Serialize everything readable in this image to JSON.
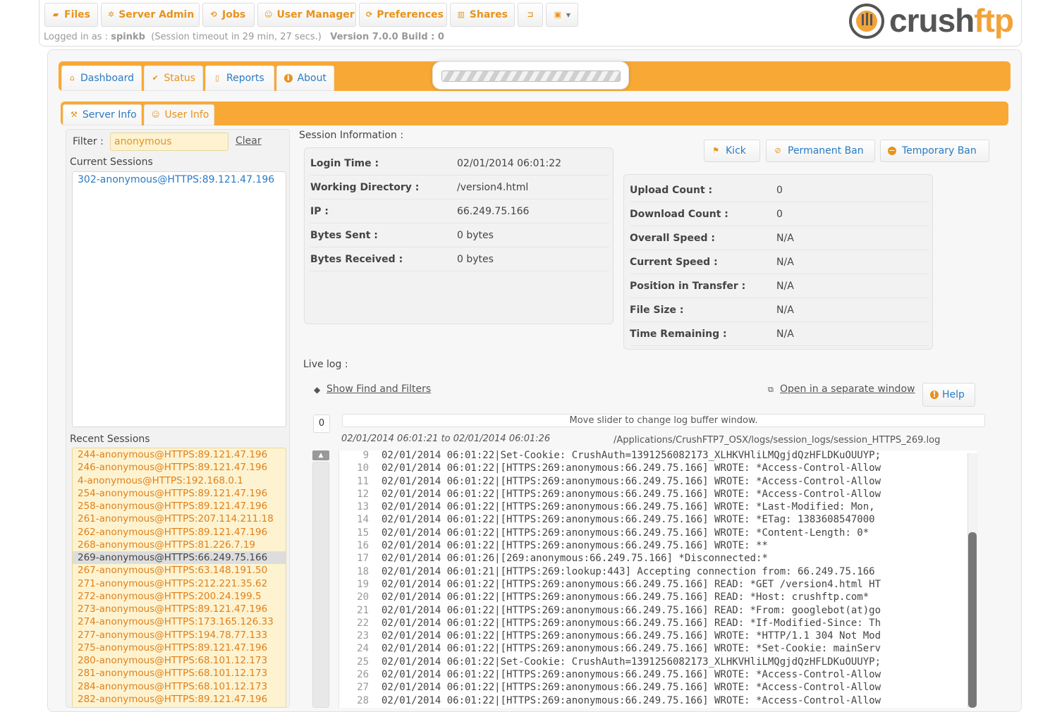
{
  "topnav": {
    "files": "Files",
    "server_admin": "Server Admin",
    "jobs": "Jobs",
    "user_manager": "User Manager",
    "preferences": "Preferences",
    "shares": "Shares"
  },
  "status_line": {
    "logged_in_label": "Logged in as :",
    "user": "spinkb",
    "timeout": "(Session timeout in 29 min, 27 secs.)",
    "version": "Version 7.0.0 Build : 0"
  },
  "logo": {
    "part1": "crush",
    "part2": "ftp"
  },
  "main_tabs": [
    "Dashboard",
    "Status",
    "Reports",
    "About"
  ],
  "sub_tabs": [
    "Server Info",
    "User Info"
  ],
  "filter": {
    "label": "Filter :",
    "value": "anonymous",
    "clear": "Clear"
  },
  "current_sessions": {
    "title": "Current Sessions",
    "items": [
      "302-anonymous@HTTPS:89.121.47.196"
    ]
  },
  "recent_sessions": {
    "title": "Recent Sessions",
    "selected_index": 8,
    "items": [
      "244-anonymous@HTTPS:89.121.47.196",
      "246-anonymous@HTTPS:89.121.47.196",
      "4-anonymous@HTTPS:192.168.0.1",
      "254-anonymous@HTTPS:89.121.47.196",
      "258-anonymous@HTTPS:89.121.47.196",
      "261-anonymous@HTTPS:207.114.211.18",
      "262-anonymous@HTTPS:89.121.47.196",
      "268-anonymous@HTTPS:81.226.7.19",
      "269-anonymous@HTTPS:66.249.75.166",
      "267-anonymous@HTTPS:63.148.191.50",
      "271-anonymous@HTTPS:212.221.35.62",
      "272-anonymous@HTTPS:200.24.199.5",
      "273-anonymous@HTTPS:89.121.47.196",
      "274-anonymous@HTTPS:173.165.126.33",
      "277-anonymous@HTTPS:194.78.77.133",
      "275-anonymous@HTTPS:89.121.47.196",
      "280-anonymous@HTTPS:68.101.12.173",
      "281-anonymous@HTTPS:68.101.12.173",
      "284-anonymous@HTTPS:68.101.12.173",
      "282-anonymous@HTTPS:89.121.47.196"
    ]
  },
  "session_info": {
    "title": "Session Information :",
    "rows": [
      {
        "k": "Login Time :",
        "v": "02/01/2014 06:01:22"
      },
      {
        "k": "Working Directory :",
        "v": "/version4.html"
      },
      {
        "k": "IP :",
        "v": "66.249.75.166"
      },
      {
        "k": "Bytes Sent :",
        "v": "0 bytes"
      },
      {
        "k": "Bytes Received :",
        "v": "0 bytes"
      }
    ]
  },
  "actions": {
    "kick": "Kick",
    "permanent_ban": "Permanent Ban",
    "temporary_ban": "Temporary Ban"
  },
  "stats": {
    "rows": [
      {
        "k": "Upload Count :",
        "v": "0"
      },
      {
        "k": "Download Count :",
        "v": "0"
      },
      {
        "k": "Overall Speed :",
        "v": "N/A"
      },
      {
        "k": "Current Speed :",
        "v": "N/A"
      },
      {
        "k": "Position in Transfer :",
        "v": "N/A"
      },
      {
        "k": "File Size :",
        "v": "N/A"
      },
      {
        "k": "Time Remaining :",
        "v": "N/A"
      }
    ]
  },
  "live_log": {
    "title": "Live log :",
    "show_find": "Show Find and Filters",
    "open_window": "Open in a separate window",
    "help": "Help",
    "slider_value": "0",
    "slider_hint": "Move slider to change log buffer window.",
    "range": "02/01/2014 06:01:21 to 02/01/2014 06:01:26",
    "path": "/Applications/CrushFTP7_OSX/logs/session_logs/session_HTTPS_269.log",
    "lines": [
      {
        "n": "9",
        "t": "02/01/2014 06:01:22|Set-Cookie: CrushAuth=1391256082173_XLHKVHliLMQgjdQzHFLDKuOUUYP;"
      },
      {
        "n": "10",
        "t": "02/01/2014 06:01:22|[HTTPS:269:anonymous:66.249.75.166] WROTE: *Access-Control-Allow"
      },
      {
        "n": "11",
        "t": "02/01/2014 06:01:22|[HTTPS:269:anonymous:66.249.75.166] WROTE: *Access-Control-Allow"
      },
      {
        "n": "12",
        "t": "02/01/2014 06:01:22|[HTTPS:269:anonymous:66.249.75.166] WROTE: *Access-Control-Allow"
      },
      {
        "n": "13",
        "t": "02/01/2014 06:01:22|[HTTPS:269:anonymous:66.249.75.166] WROTE: *Last-Modified: Mon,"
      },
      {
        "n": "14",
        "t": "02/01/2014 06:01:22|[HTTPS:269:anonymous:66.249.75.166] WROTE: *ETag: 1383608547000"
      },
      {
        "n": "15",
        "t": "02/01/2014 06:01:22|[HTTPS:269:anonymous:66.249.75.166] WROTE: *Content-Length: 0*"
      },
      {
        "n": "16",
        "t": "02/01/2014 06:01:22|[HTTPS:269:anonymous:66.249.75.166] WROTE: **"
      },
      {
        "n": "17",
        "t": "02/01/2014 06:01:26|[269:anonymous:66.249.75.166] *Disconnected:*"
      },
      {
        "n": "18",
        "t": "02/01/2014 06:01:21|[HTTPS:269:lookup:443] Accepting connection from: 66.249.75.166"
      },
      {
        "n": "19",
        "t": "02/01/2014 06:01:22|[HTTPS:269:anonymous:66.249.75.166] READ: *GET /version4.html HT"
      },
      {
        "n": "20",
        "t": "02/01/2014 06:01:22|[HTTPS:269:anonymous:66.249.75.166] READ: *Host: crushftp.com*"
      },
      {
        "n": "21",
        "t": "02/01/2014 06:01:22|[HTTPS:269:anonymous:66.249.75.166] READ: *From: googlebot(at)go"
      },
      {
        "n": "22",
        "t": "02/01/2014 06:01:22|[HTTPS:269:anonymous:66.249.75.166] READ: *If-Modified-Since: Th"
      },
      {
        "n": "23",
        "t": "02/01/2014 06:01:22|[HTTPS:269:anonymous:66.249.75.166] WROTE: *HTTP/1.1 304 Not Mod"
      },
      {
        "n": "24",
        "t": "02/01/2014 06:01:22|[HTTPS:269:anonymous:66.249.75.166] WROTE: *Set-Cookie: mainServ"
      },
      {
        "n": "25",
        "t": "02/01/2014 06:01:22|Set-Cookie: CrushAuth=1391256082173_XLHKVHliLMQgjdQzHFLDKuOUUYP;"
      },
      {
        "n": "26",
        "t": "02/01/2014 06:01:22|[HTTPS:269:anonymous:66.249.75.166] WROTE: *Access-Control-Allow"
      },
      {
        "n": "27",
        "t": "02/01/2014 06:01:22|[HTTPS:269:anonymous:66.249.75.166] WROTE: *Access-Control-Allow"
      },
      {
        "n": "28",
        "t": "02/01/2014 06:01:22|[HTTPS:269:anonymous:66.249.75.166] WROTE: *Access-Control-Allow"
      }
    ]
  },
  "colors": {
    "accent": "#f8a935",
    "link": "#2a7bc2",
    "nav_text": "#e8931c",
    "recent_bg": "#fdf3d1"
  }
}
